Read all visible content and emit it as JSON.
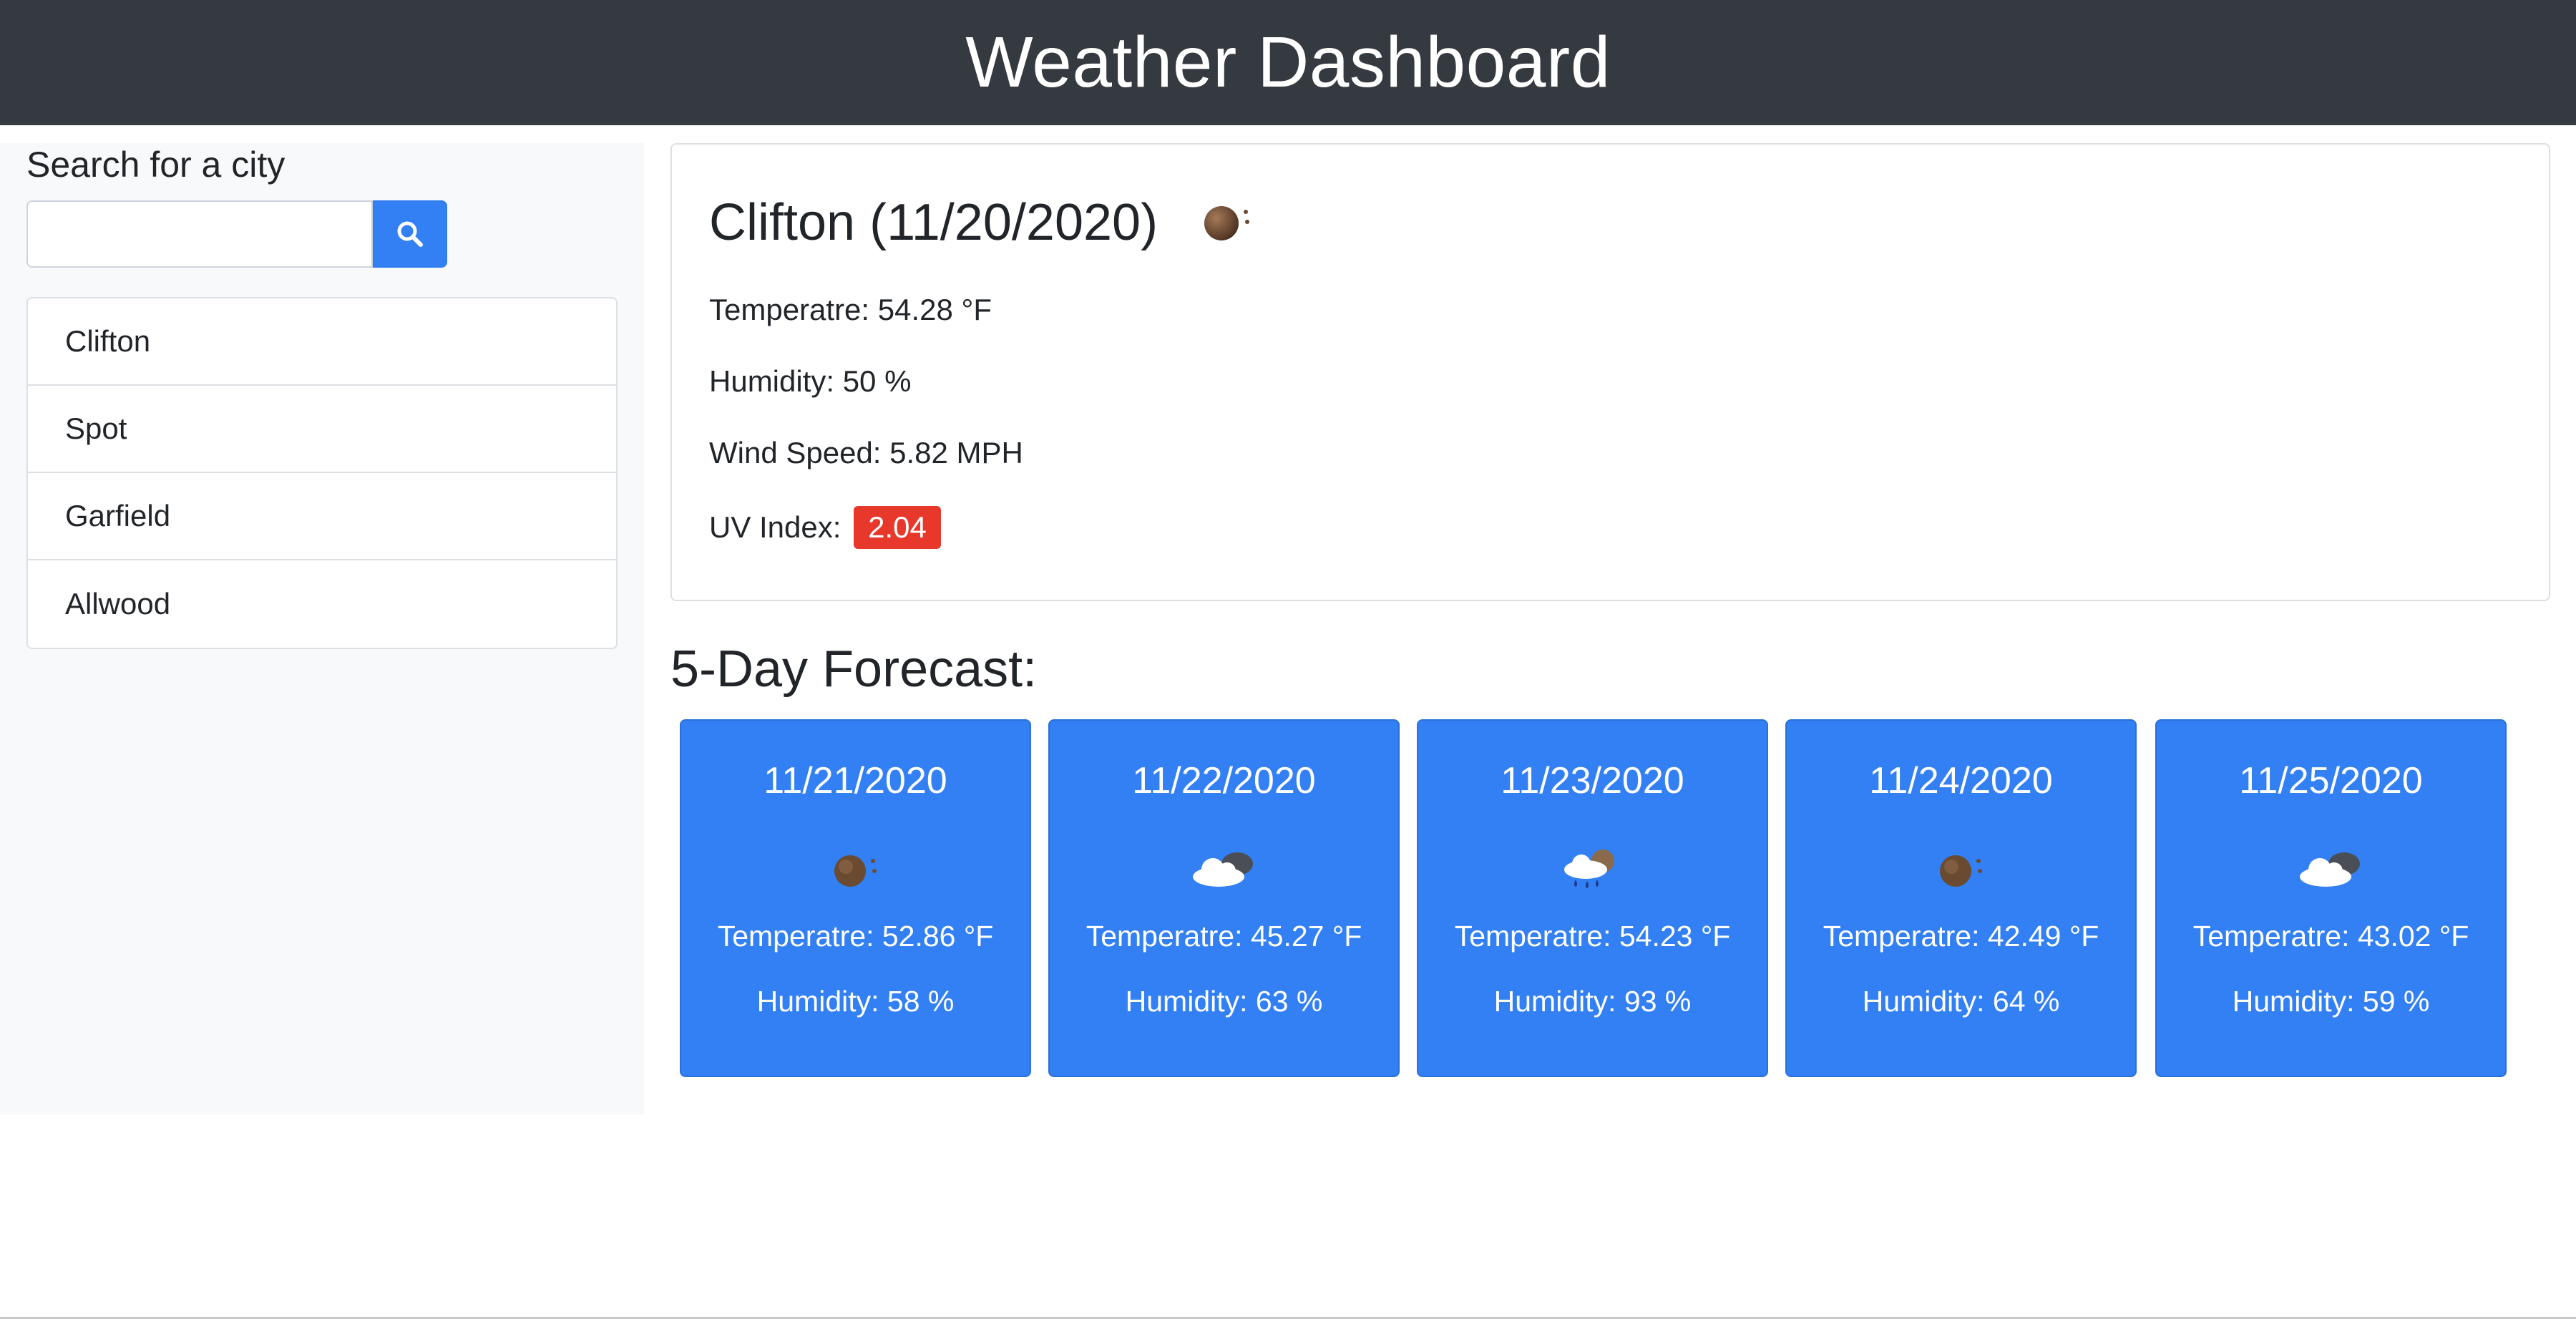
{
  "header": {
    "title": "Weather Dashboard"
  },
  "search": {
    "title": "Search for a city",
    "input_value": "",
    "button_icon": "search-icon"
  },
  "history": [
    {
      "label": "Clifton"
    },
    {
      "label": "Spot"
    },
    {
      "label": "Garfield"
    },
    {
      "label": "Allwood"
    }
  ],
  "current": {
    "title": "Clifton (11/20/2020)",
    "icon": "clear-night-icon",
    "temperature": "Temperatre: 54.28 °F",
    "humidity": "Humidity: 50 %",
    "wind": "Wind Speed: 5.82 MPH",
    "uv_label": "UV Index:",
    "uv_value": "2.04",
    "uv_color": "#e8372b"
  },
  "forecast": {
    "title": "5-Day Forecast:",
    "card_color": "#3280f3",
    "days": [
      {
        "date": "11/21/2020",
        "icon": "clear-night-icon",
        "temp": "Temperatre: 52.86 °F",
        "humidity": "Humidity: 58 %"
      },
      {
        "date": "11/22/2020",
        "icon": "cloudy-night-icon",
        "temp": "Temperatre: 45.27 °F",
        "humidity": "Humidity: 63 %"
      },
      {
        "date": "11/23/2020",
        "icon": "rain-night-icon",
        "temp": "Temperatre: 54.23 °F",
        "humidity": "Humidity: 93 %"
      },
      {
        "date": "11/24/2020",
        "icon": "clear-night-icon",
        "temp": "Temperatre: 42.49 °F",
        "humidity": "Humidity: 64 %"
      },
      {
        "date": "11/25/2020",
        "icon": "cloudy-night-icon",
        "temp": "Temperatre: 43.02 °F",
        "humidity": "Humidity: 59 %"
      }
    ]
  }
}
